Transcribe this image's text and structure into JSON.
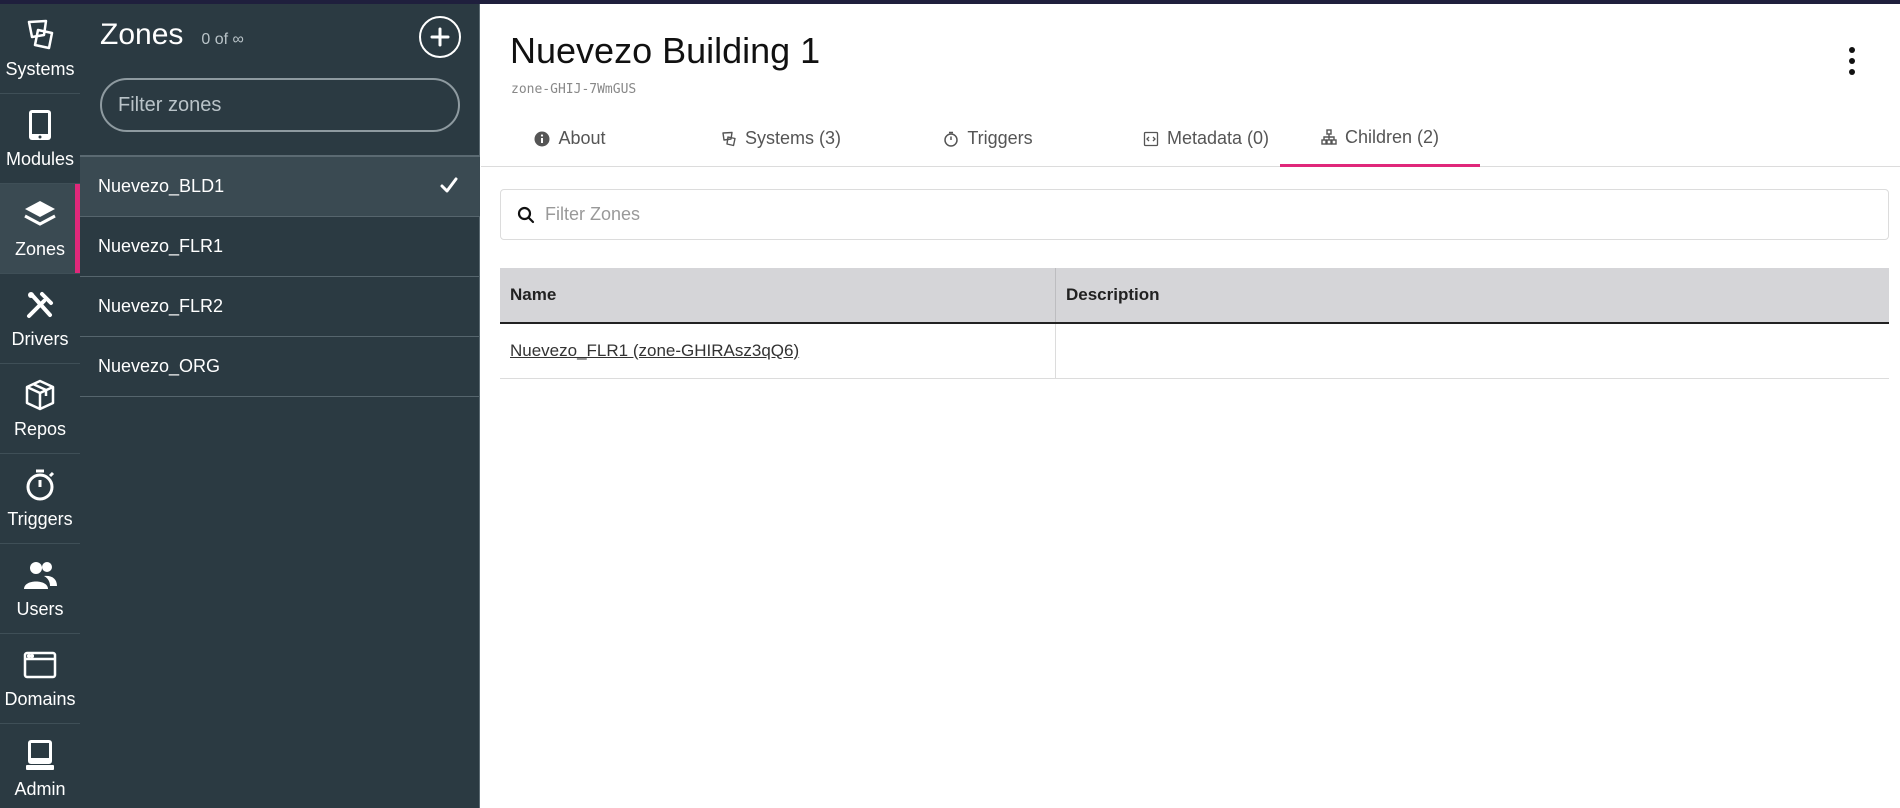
{
  "nav": {
    "items": [
      {
        "label": "Systems",
        "icon": "systems-icon"
      },
      {
        "label": "Modules",
        "icon": "tablet-icon"
      },
      {
        "label": "Zones",
        "icon": "layers-icon",
        "active": true
      },
      {
        "label": "Drivers",
        "icon": "tools-icon"
      },
      {
        "label": "Repos",
        "icon": "box-icon"
      },
      {
        "label": "Triggers",
        "icon": "stopwatch-icon"
      },
      {
        "label": "Users",
        "icon": "users-icon"
      },
      {
        "label": "Domains",
        "icon": "browser-window-icon"
      },
      {
        "label": "Admin",
        "icon": "computer-icon"
      }
    ]
  },
  "zones": {
    "title": "Zones",
    "count": "0 of ∞",
    "filter_placeholder": "Filter zones",
    "items": [
      {
        "label": "Nuevezo_BLD1",
        "selected": true
      },
      {
        "label": "Nuevezo_FLR1"
      },
      {
        "label": "Nuevezo_FLR2"
      },
      {
        "label": "Nuevezo_ORG"
      }
    ]
  },
  "detail": {
    "title": "Nuevezo Building 1",
    "id": "zone-GHIJ-7WmGUS",
    "tabs": [
      {
        "label": "About",
        "icon": "info-icon"
      },
      {
        "label": "Systems  (3)",
        "icon": "systems-icon"
      },
      {
        "label": "Triggers",
        "icon": "stopwatch-icon"
      },
      {
        "label": "Metadata  (0)",
        "icon": "code-icon"
      },
      {
        "label": "Children  (2)",
        "icon": "hierarchy-icon",
        "active": true
      }
    ],
    "filter_placeholder": "Filter Zones",
    "table": {
      "headers": [
        "Name",
        "Description"
      ],
      "rows": [
        {
          "name": "Nuevezo_FLR1 (zone-GHIRAsz3qQ6)",
          "description": ""
        }
      ]
    }
  },
  "colors": {
    "sidebar_bg": "#2b3a42",
    "accent": "#e0287a",
    "table_header_bg": "#d5d5d8"
  }
}
